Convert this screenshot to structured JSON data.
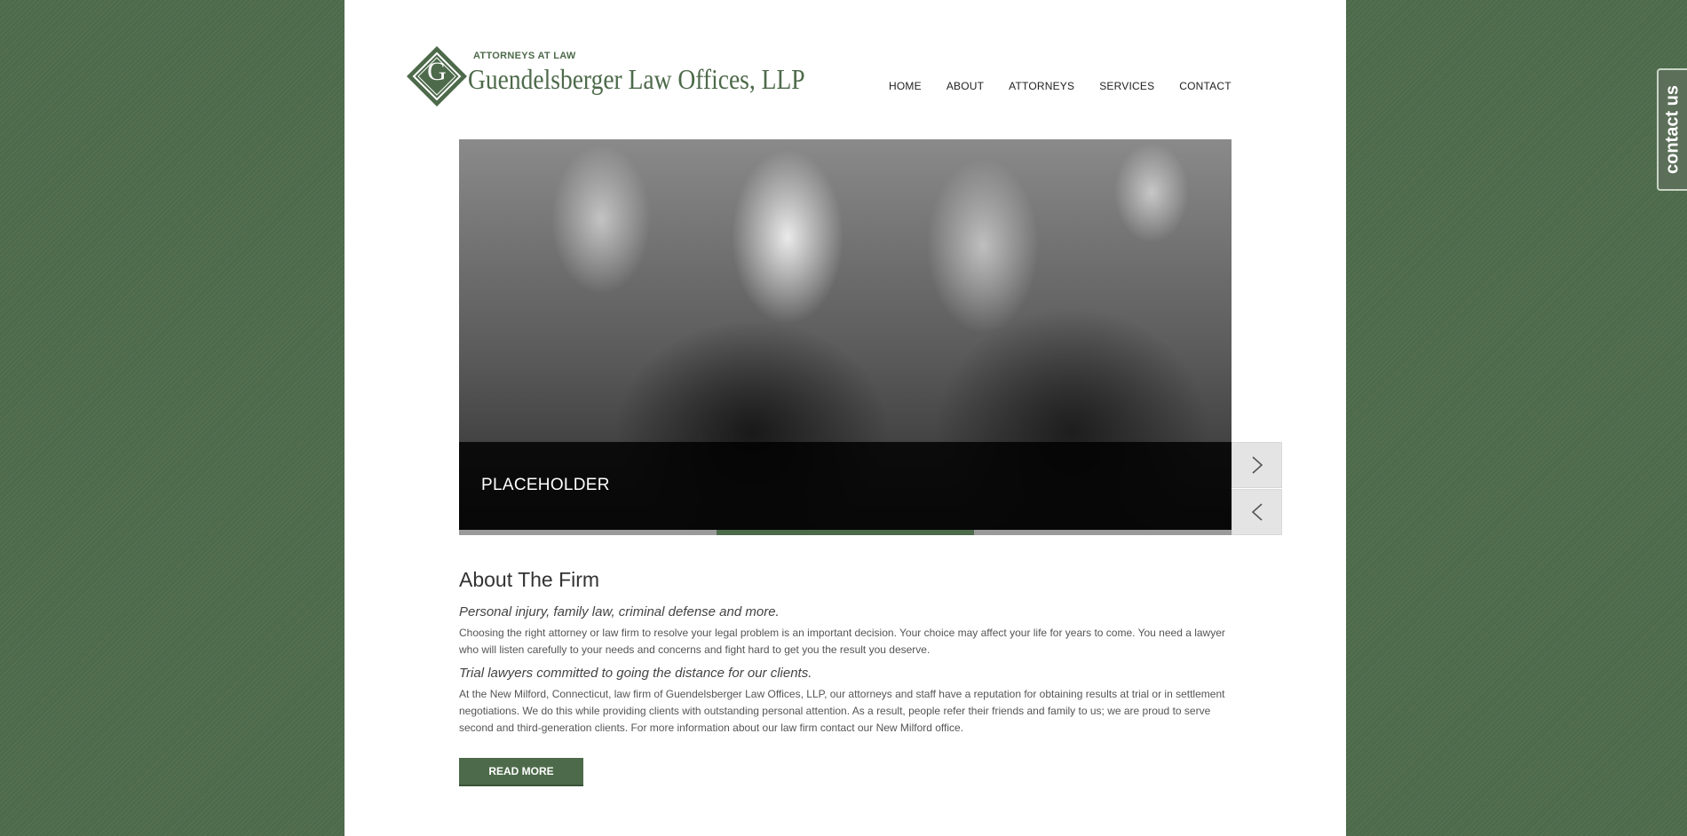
{
  "header": {
    "logo_letter": "G",
    "logo_tagline": "ATTORNEYS AT LAW",
    "logo_name": "Guendelsberger Law Offices, LLP",
    "nav": [
      "HOME",
      "ABOUT",
      "ATTORNEYS",
      "SERVICES",
      "CONTACT"
    ]
  },
  "slider": {
    "caption": "PLACEHOLDER",
    "next_icon": "chevron-right-icon",
    "prev_icon": "chevron-left-icon",
    "slides_count": 3,
    "active_slide": 2
  },
  "content": {
    "title": "About The Firm",
    "subtitle1": "Personal injury, family law, criminal defense and more.",
    "paragraph1": "Choosing the right attorney or law firm to resolve your legal problem is an important decision. Your choice may affect your life for years to come. You need a lawyer who will listen carefully to your needs and concerns and fight hard to get you the result you deserve.",
    "subtitle2": "Trial lawyers committed to going the distance for our clients.",
    "paragraph2": "At the New Milford, Connecticut, law firm of Guendelsberger Law Offices, LLP, our attorneys and staff have a reputation for obtaining results at trial or in settlement negotiations. We do this while providing clients with outstanding personal attention. As a result, people refer their friends and family to us; we are proud to serve second and third-generation clients. For more information about our law firm contact our New Milford office.",
    "read_more": "READ MORE"
  },
  "contact_tab": "contact us",
  "colors": {
    "brand_green": "#4d6a4a",
    "background": "#4d6a4a",
    "page": "#ffffff"
  }
}
